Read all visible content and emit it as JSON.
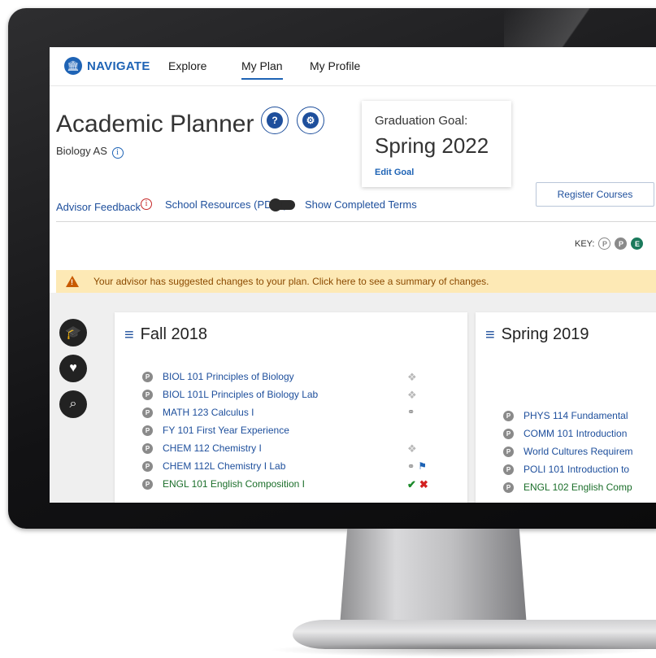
{
  "nav": {
    "logo_text": "NAVIGATE",
    "items": [
      {
        "label": "Explore"
      },
      {
        "label": "My Plan",
        "active": true
      },
      {
        "label": "My Profile"
      }
    ]
  },
  "header": {
    "title": "Academic Planner",
    "program": "Biology AS",
    "help_icon": "question-icon",
    "settings_icon": "gear-icon"
  },
  "goal": {
    "label": "Graduation Goal:",
    "value": "Spring 2022",
    "edit_label": "Edit Goal"
  },
  "actions": {
    "register_label": "Register Courses",
    "advisor_feedback": "Advisor Feedback",
    "school_resources": "School Resources (PDFs)",
    "show_completed": "Show Completed Terms"
  },
  "key": {
    "label": "KEY:",
    "badges": [
      "P",
      "P",
      "E"
    ]
  },
  "alert": {
    "text": "Your advisor has suggested changes to your plan. Click here to see a summary of changes."
  },
  "side_icons": [
    "graduation-cap-icon",
    "heart-icon",
    "search-icon"
  ],
  "terms": [
    {
      "title": "Fall 2018",
      "courses": [
        {
          "badge": "P",
          "label": "BIOL 101 Principles of Biology"
        },
        {
          "badge": "P",
          "label": "BIOL 101L Principles of Biology Lab"
        },
        {
          "badge": "P",
          "label": "MATH 123 Calculus I"
        },
        {
          "badge": "P",
          "label": "FY 101 First Year Experience"
        },
        {
          "badge": "P",
          "label": "CHEM 112 Chemistry I"
        },
        {
          "badge": "P",
          "label": "CHEM 112L Chemistry I Lab"
        },
        {
          "badge": "P",
          "label": "ENGL 101 English Composition I"
        }
      ]
    },
    {
      "title": "Spring 2019",
      "courses": [
        {
          "badge": "P",
          "label": "PHYS 114 Fundamental"
        },
        {
          "badge": "P",
          "label": "COMM 101 Introduction"
        },
        {
          "badge": "P",
          "label": "World Cultures Requirem"
        },
        {
          "badge": "P",
          "label": "POLI 101 Introduction to"
        },
        {
          "badge": "P",
          "label": "ENGL 102 English Comp"
        }
      ]
    }
  ],
  "colors": {
    "brand": "#1e63b5",
    "link": "#1e4f9c",
    "alert_bg": "#fde9b5",
    "completed": "#1b6e2a"
  }
}
